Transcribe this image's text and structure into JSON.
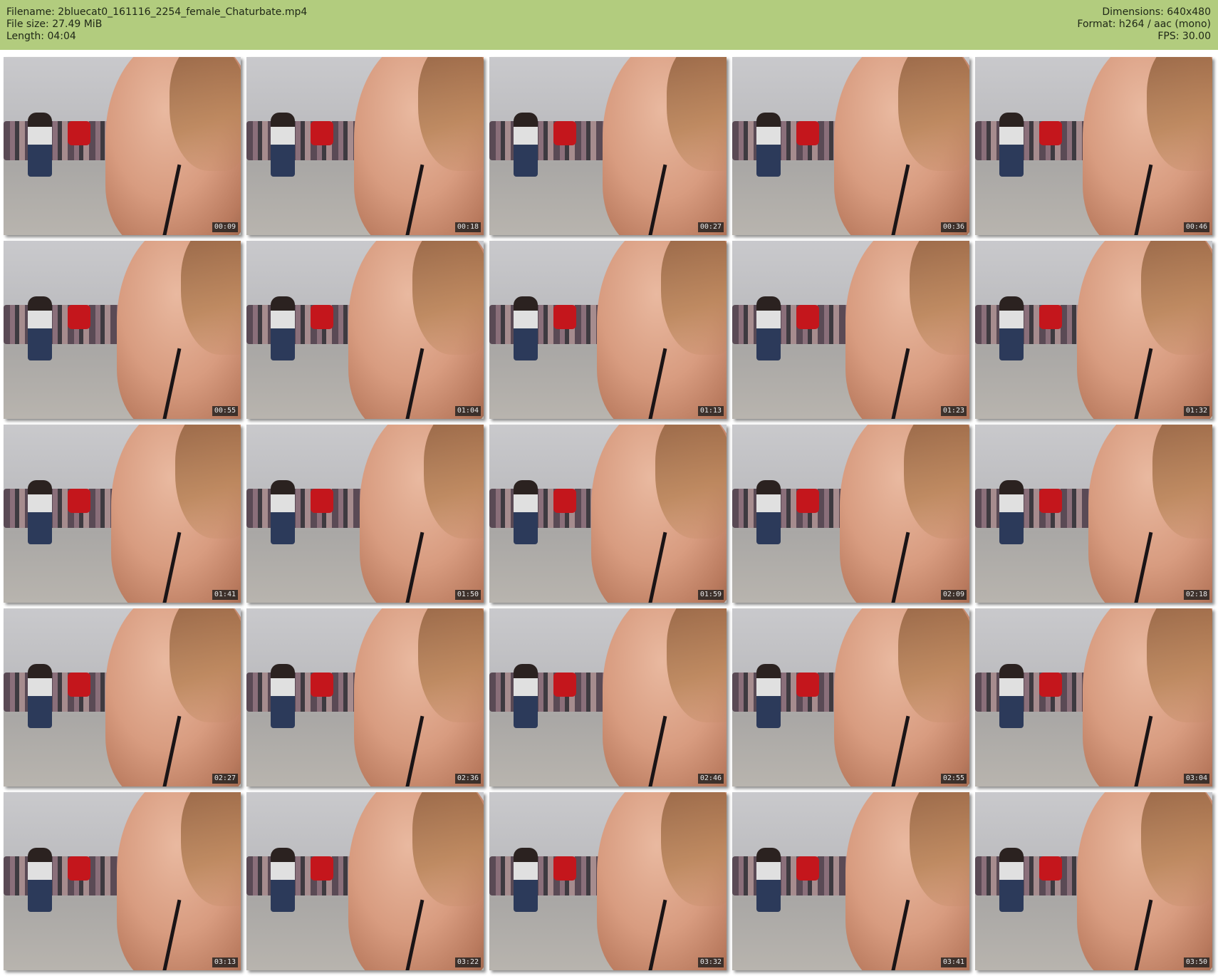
{
  "header": {
    "filename": "Filename: 2bluecat0_161116_2254_female_Chaturbate.mp4",
    "file_size": "File size: 27.49 MiB",
    "length": "Length: 04:04",
    "dimensions": "Dimensions: 640x480",
    "format": "Format: h264 / aac (mono)",
    "fps": "FPS: 30.00"
  },
  "colors": {
    "header_bg": "#b2cc7e"
  },
  "thumbnails": [
    {
      "time": "00:09"
    },
    {
      "time": "00:18"
    },
    {
      "time": "00:27"
    },
    {
      "time": "00:36"
    },
    {
      "time": "00:46"
    },
    {
      "time": "00:55"
    },
    {
      "time": "01:04"
    },
    {
      "time": "01:13"
    },
    {
      "time": "01:23"
    },
    {
      "time": "01:32"
    },
    {
      "time": "01:41"
    },
    {
      "time": "01:50"
    },
    {
      "time": "01:59"
    },
    {
      "time": "02:09"
    },
    {
      "time": "02:18"
    },
    {
      "time": "02:27"
    },
    {
      "time": "02:36"
    },
    {
      "time": "02:46"
    },
    {
      "time": "02:55"
    },
    {
      "time": "03:04"
    },
    {
      "time": "03:13"
    },
    {
      "time": "03:22"
    },
    {
      "time": "03:32"
    },
    {
      "time": "03:41"
    },
    {
      "time": "03:50"
    }
  ]
}
